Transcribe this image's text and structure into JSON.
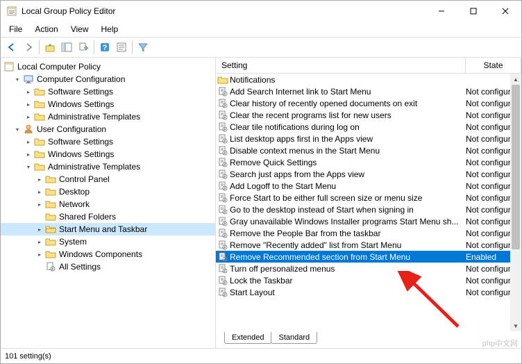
{
  "window": {
    "title": "Local Group Policy Editor"
  },
  "menu": {
    "file": "File",
    "action": "Action",
    "view": "View",
    "help": "Help"
  },
  "tree": {
    "root": "Local Computer Policy",
    "cc": "Computer Configuration",
    "uc": "User Configuration",
    "ss": "Software Settings",
    "ws": "Windows Settings",
    "at": "Administrative Templates",
    "cp": "Control Panel",
    "dt": "Desktop",
    "nw": "Network",
    "sf": "Shared Folders",
    "smt": "Start Menu and Taskbar",
    "sys": "System",
    "wc": "Windows Components",
    "as": "All Settings"
  },
  "columns": {
    "setting": "Setting",
    "state": "State"
  },
  "notifications_folder": "Notifications",
  "rows": [
    {
      "name": "Add Search Internet link to Start Menu",
      "state": "Not configured"
    },
    {
      "name": "Clear history of recently opened documents on exit",
      "state": "Not configured"
    },
    {
      "name": "Clear the recent programs list for new users",
      "state": "Not configured"
    },
    {
      "name": "Clear tile notifications during log on",
      "state": "Not configured"
    },
    {
      "name": "List desktop apps first in the Apps view",
      "state": "Not configured"
    },
    {
      "name": "Disable context menus in the Start Menu",
      "state": "Not configured"
    },
    {
      "name": "Remove Quick Settings",
      "state": "Not configured"
    },
    {
      "name": "Search just apps from the Apps view",
      "state": "Not configured"
    },
    {
      "name": "Add Logoff to the Start Menu",
      "state": "Not configured"
    },
    {
      "name": "Force Start to be either full screen size or menu size",
      "state": "Not configured"
    },
    {
      "name": "Go to the desktop instead of Start when signing in",
      "state": "Not configured"
    },
    {
      "name": "Gray unavailable Windows Installer programs Start Menu sh...",
      "state": "Not configured"
    },
    {
      "name": "Remove the People Bar from the taskbar",
      "state": "Not configured"
    },
    {
      "name": "Remove \"Recently added\" list from Start Menu",
      "state": "Not configured"
    },
    {
      "name": "Remove Recommended section from Start Menu",
      "state": "Enabled",
      "selected": true
    },
    {
      "name": "Turn off personalized menus",
      "state": "Not configured"
    },
    {
      "name": "Lock the Taskbar",
      "state": "Not configured"
    },
    {
      "name": "Start Layout",
      "state": "Not configured"
    }
  ],
  "tabs": {
    "extended": "Extended",
    "standard": "Standard"
  },
  "status": "101 setting(s)",
  "watermark": "php中文网"
}
